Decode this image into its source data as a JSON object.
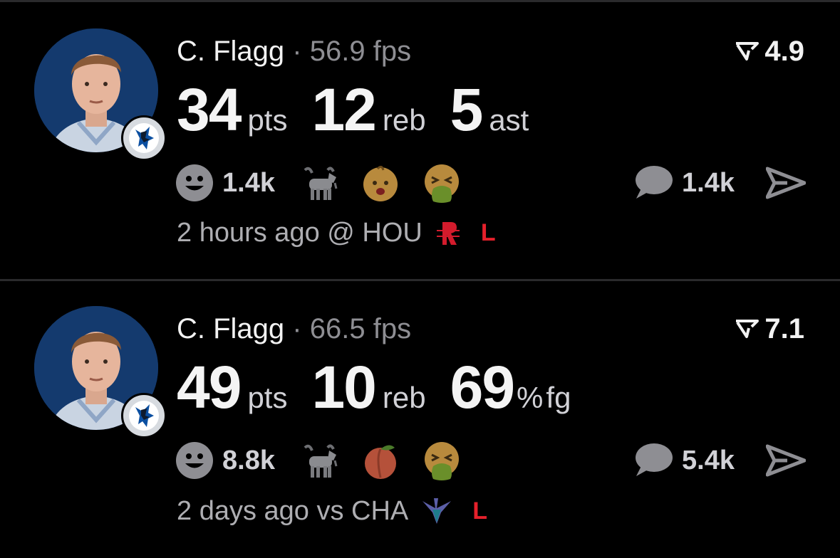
{
  "posts": [
    {
      "player": "C. Flagg",
      "separator": "·",
      "fps": "56.9 fps",
      "score": "4.9",
      "stats": [
        {
          "value": "34",
          "unit": "pts"
        },
        {
          "value": "12",
          "unit": "reb"
        },
        {
          "value": "5",
          "unit": "ast"
        }
      ],
      "reactions": {
        "smile_count": "1.4k",
        "emojis": [
          "goat-icon",
          "baby-face-icon",
          "vomit-face-icon"
        ]
      },
      "comments": "1.4k",
      "time_location": "2 hours ago @ HOU",
      "opponent_logo": "rockets-logo-icon",
      "result": "L"
    },
    {
      "player": "C. Flagg",
      "separator": "·",
      "fps": "66.5 fps",
      "score": "7.1",
      "stats": [
        {
          "value": "49",
          "unit": "pts"
        },
        {
          "value": "10",
          "unit": "reb"
        },
        {
          "value": "69",
          "unit": "%",
          "unit2": "fg"
        }
      ],
      "reactions": {
        "smile_count": "8.8k",
        "emojis": [
          "goat-icon",
          "peach-icon",
          "vomit-face-icon"
        ]
      },
      "comments": "5.4k",
      "time_location": "2 days ago vs CHA",
      "opponent_logo": "hornets-logo-icon",
      "result": "L"
    }
  ],
  "colors": {
    "background": "#000000",
    "loss": "#e5202b",
    "muted": "#8e8e93",
    "team_navy": "#143a6e"
  }
}
